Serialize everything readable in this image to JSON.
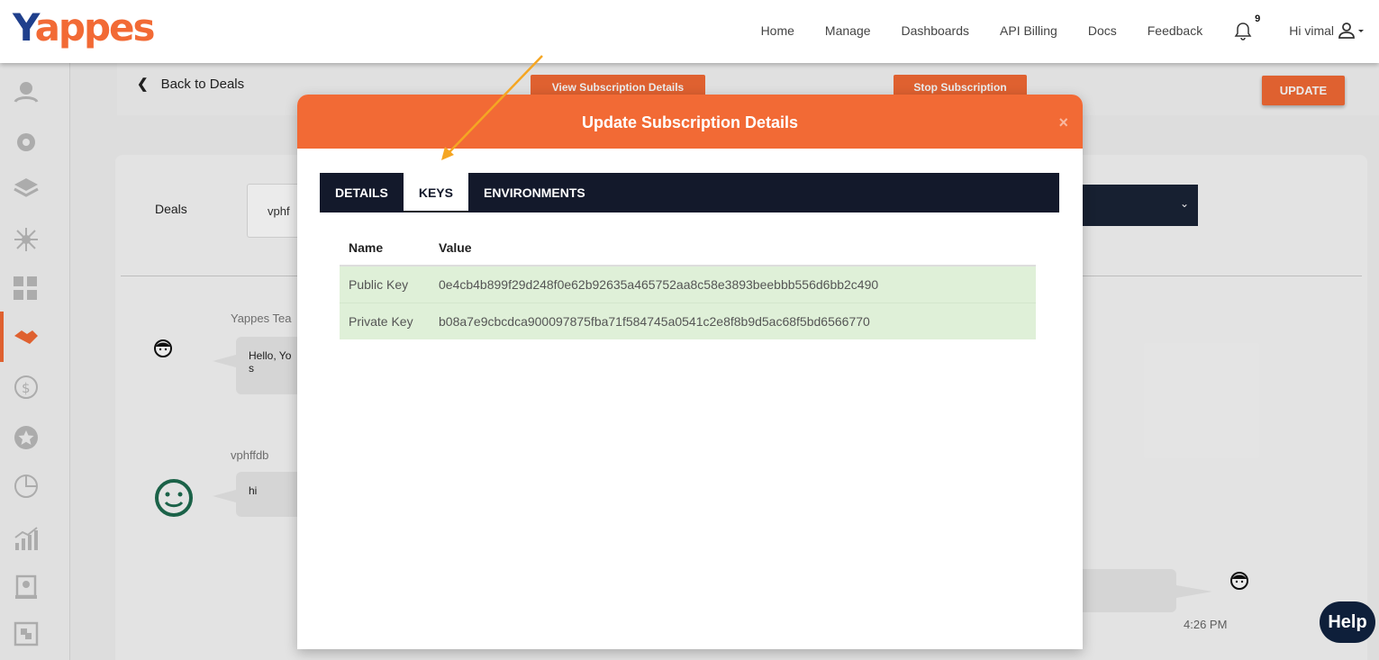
{
  "header": {
    "logo_text": "Yappes",
    "nav": [
      "Home",
      "Manage",
      "Dashboards",
      "API Billing",
      "Docs",
      "Feedback"
    ],
    "notification_count": "9",
    "greeting": "Hi vimal"
  },
  "sidebar": {
    "icons": [
      "users-icon",
      "gear-api-icon",
      "layers-icon",
      "network-icon",
      "grid-icon",
      "handshake-icon",
      "refund-icon",
      "star-badge-icon",
      "pie-chart-icon",
      "growth-chart-icon",
      "certificate-icon",
      "document-icon"
    ],
    "active_index": 5
  },
  "page": {
    "back_label": "Back to Deals",
    "view_subscription_label": "View Subscription Details",
    "stop_subscription_label": "Stop Subscription",
    "update_label": "UPDATE",
    "deals_label": "Deals",
    "deals_value": "vphf",
    "chat": [
      {
        "name": "Yappes Tea",
        "message": "Hello, Yo\ns"
      },
      {
        "name": "vphffdb",
        "message": "hi"
      }
    ],
    "time": "4:26 PM",
    "help_label": "Help"
  },
  "modal": {
    "title": "Update Subscription Details",
    "close": "×",
    "tabs": [
      "DETAILS",
      "KEYS",
      "ENVIRONMENTS"
    ],
    "active_tab": "KEYS",
    "table": {
      "headers": [
        "Name",
        "Value"
      ],
      "rows": [
        [
          "Public Key",
          "0e4cb4b899f29d248f0e62b92635a465752aa8c58e3893beebbb556d6bb2c490"
        ],
        [
          "Private Key",
          "b08a7e9cbcdca900097875fba71f584745a0541c2e8f8b9d5ac68f5bd6566770"
        ]
      ]
    }
  },
  "colors": {
    "accent": "#f26a35",
    "dark_nav": "#13192b",
    "row_highlight": "#dff0d8"
  }
}
